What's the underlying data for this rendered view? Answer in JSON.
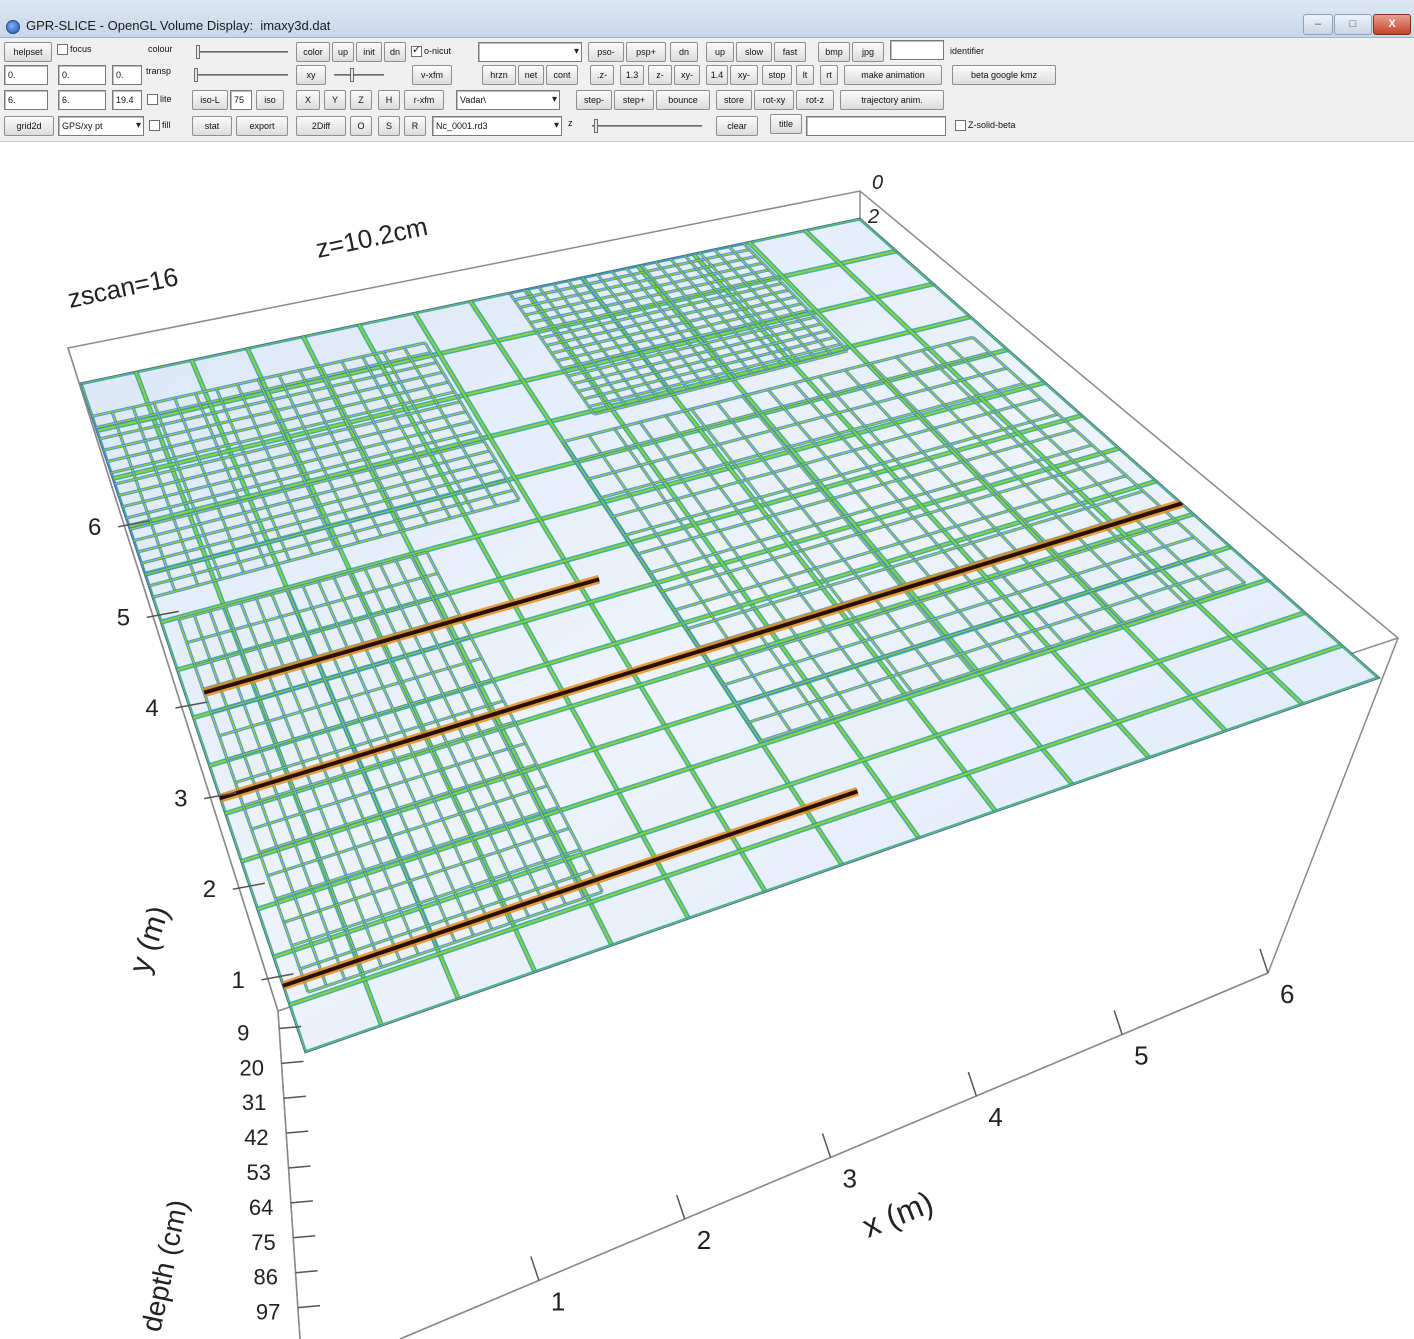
{
  "window": {
    "title": "GPR-SLICE - OpenGL Volume Display:  imaxy3d.dat",
    "min_label": "–",
    "max_label": "□",
    "close_label": "X"
  },
  "toolbar": {
    "row1": {
      "helpset": "helpset",
      "focus": "focus",
      "colour": "colour",
      "color": "color",
      "up": "up",
      "init": "init",
      "dn": "dn",
      "o_nicut": "o-nicut",
      "pso_minus": "pso-",
      "psp_plus": "psp+",
      "dn2": "dn",
      "up2": "up",
      "slow": "slow",
      "fast": "fast",
      "bmp": "bmp",
      "jpg": "jpg",
      "identifier_value": "",
      "identifier_label": "identifier"
    },
    "row2": {
      "f1": "0.",
      "f2": "0.",
      "f3": "0.",
      "transp": "transp",
      "xy": "xy",
      "vxfm": "v-xfm",
      "hrzn": "hrzn",
      "net": "net",
      "cont": "cont",
      "z_small": ".z-",
      "v13": "1.3",
      "z_minus": "z-",
      "xy_minus": "xy-",
      "v14": "1.4",
      "xy_dash": "xy-",
      "stop": "stop",
      "lt": "lt",
      "rt": "rt",
      "make_animation": "make animation",
      "beta_google_kmz": "beta google kmz"
    },
    "row3": {
      "f1": "6.",
      "f2": "6.",
      "f3": "19.4",
      "lite": "lite",
      "iso_l": "iso-L",
      "iso_value": "75",
      "iso": "iso",
      "x": "X",
      "y": "Y",
      "z": "Z",
      "h": "H",
      "rxfm": "r-xfm",
      "palette": "Vadar\\",
      "step_minus": "step-",
      "step_plus": "step+",
      "bounce": "bounce",
      "store": "store",
      "rot_xy": "rot-xy",
      "rot_z": "rot-z",
      "trajectory_anim": "trajectory anim."
    },
    "row4": {
      "grid2d": "grid2d",
      "gps": "GPS/xy pt",
      "fill": "fill",
      "stat": "stat",
      "export": "export",
      "twod_diff": "2Diff",
      "o": "O",
      "s": "S",
      "r": "R",
      "file": "Nc_0001.rd3",
      "z_label": "z",
      "clear": "clear",
      "title": "title",
      "title_value": "",
      "z_solid": "Z-solid-beta"
    }
  },
  "plot": {
    "zscan_label": "zscan=16",
    "z_label": "z=10.2cm",
    "x_axis_label": "x (m)",
    "y_axis_label": "y (m)",
    "depth_axis_label": "depth (cm)",
    "x_ticks": [
      "1",
      "2",
      "3",
      "4",
      "5",
      "6"
    ],
    "y_ticks": [
      "1",
      "2",
      "3",
      "4",
      "5",
      "6"
    ],
    "depth_ticks": [
      "9",
      "20",
      "31",
      "42",
      "53",
      "64",
      "75",
      "86",
      "97"
    ],
    "corner_ticks": [
      "0",
      "2"
    ],
    "colormap": [
      "#1b3ea8",
      "#3a7fd0",
      "#27a58f",
      "#8fd13a",
      "#e3e21e",
      "#e08a12",
      "#8a2a0a",
      "#2a0f05"
    ]
  }
}
